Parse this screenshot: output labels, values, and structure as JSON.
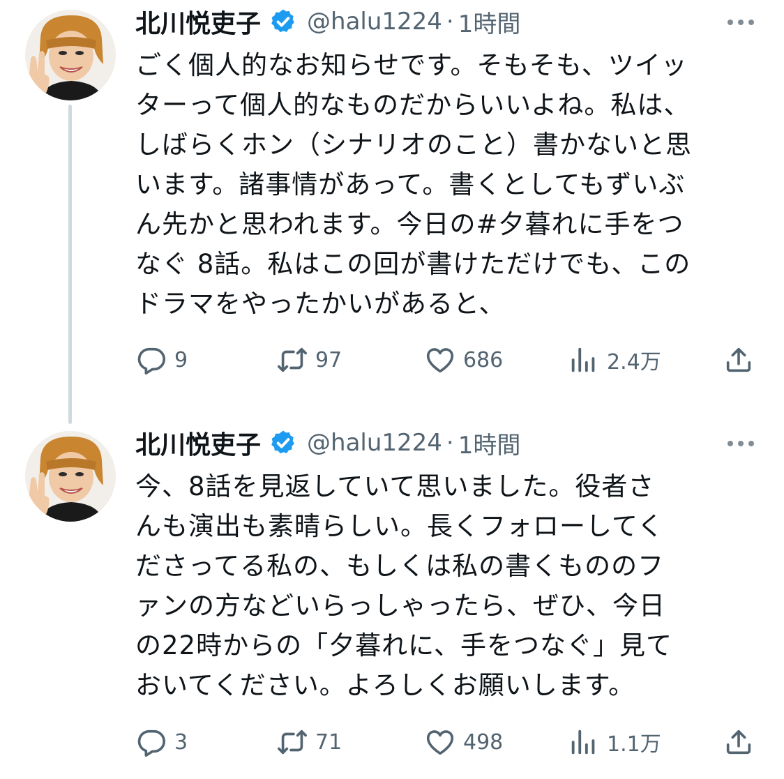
{
  "colors": {
    "verified": "#1d9bf0",
    "text": "#0f1419",
    "secondary": "#536471",
    "thread_line": "#cfd9de"
  },
  "tweets": [
    {
      "display_name": "北川悦吏子",
      "handle": "@halu1224",
      "separator": "·",
      "time": "1時間",
      "lines": [
        "ごく個人的なお知らせです。そもそも、ツイッ",
        "ターって個人的なものだからいいよね。私は、",
        "しばらくホン（シナリオのこと）書かないと思",
        "います。諸事情があって。書くとしてもずいぶ",
        "ん先かと思われます。今日の#夕暮れに手をつ",
        "なぐ 8話。私はこの回が書けただけでも、この",
        "ドラマをやったかいがあると、"
      ],
      "reply_count": "9",
      "repost_count": "97",
      "like_count": "686",
      "view_count": "2.4万"
    },
    {
      "display_name": "北川悦吏子",
      "handle": "@halu1224",
      "separator": "·",
      "time": "1時間",
      "lines": [
        "今、8話を見返していて思いました。役者さ",
        "んも演出も素晴らしい。長くフォローしてく",
        "ださってる私の、もしくは私の書くもののフ",
        "ァンの方などいらっしゃったら、ぜひ、今日",
        "の22時からの「夕暮れに、手をつなぐ」見て",
        "おいてください。よろしくお願いします。"
      ],
      "reply_count": "3",
      "repost_count": "71",
      "like_count": "498",
      "view_count": "1.1万"
    }
  ],
  "icons": {
    "avatar": "avatar-photo",
    "verified": "verified-badge-icon",
    "more": "more-dots-icon",
    "reply": "reply-bubble-icon",
    "repost": "repost-arrows-icon",
    "like": "heart-icon",
    "views": "bar-chart-icon",
    "share": "share-upload-icon"
  }
}
